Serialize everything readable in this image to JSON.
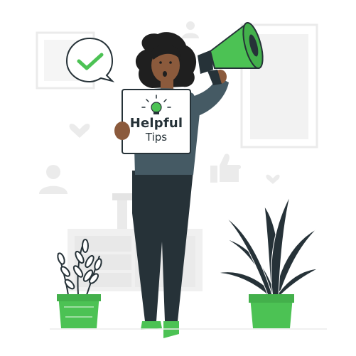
{
  "sign": {
    "title": "Helpful",
    "subtitle": "Tips"
  },
  "colors": {
    "accent": "#4CC254",
    "dark": "#263238",
    "skin": "#8B5A3C",
    "hair": "#1F1F1F",
    "light_gray": "#EBEBEB",
    "mid_gray": "#E0E0E0"
  },
  "icons": [
    "checkmark-bubble-icon",
    "lightbulb-icon",
    "megaphone-icon",
    "heart-icon",
    "thumbs-up-icon",
    "user-icon"
  ]
}
